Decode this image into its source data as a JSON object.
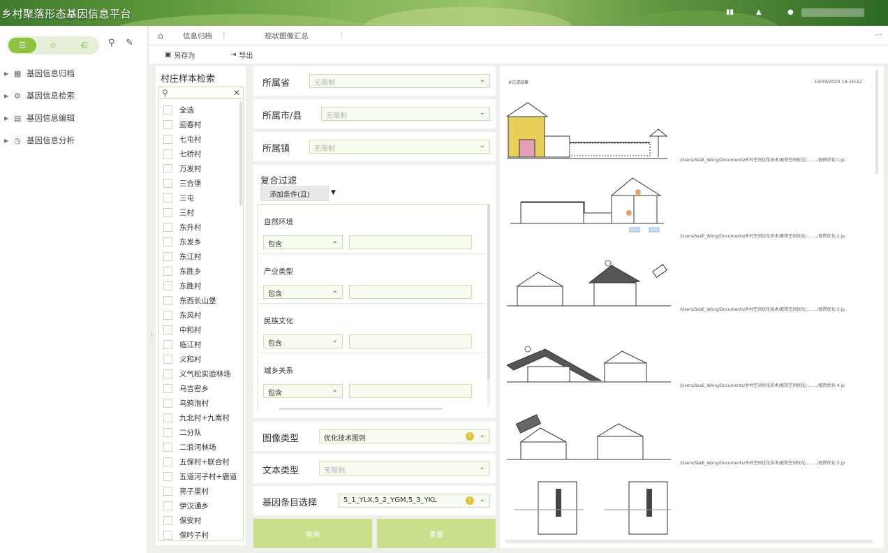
{
  "header": {
    "title": "乡村聚落形态基因信息平台"
  },
  "sidebar": {
    "menu": [
      {
        "label": "基因信息归档",
        "icon": "grid-icon"
      },
      {
        "label": "基因信息检索",
        "icon": "search-gear-icon"
      },
      {
        "label": "基因信息编辑",
        "icon": "edit-icon"
      },
      {
        "label": "基因信息分析",
        "icon": "clock-chart-icon"
      }
    ]
  },
  "tabs": [
    {
      "label": "信息归档"
    },
    {
      "label": "现状图像汇总"
    }
  ],
  "toolbar": {
    "save_as": "另存为",
    "export": "导出"
  },
  "village_search": {
    "title": "村庄样本检索",
    "items": [
      "全选",
      "迎春村",
      "七屯村",
      "七桥村",
      "万发村",
      "三合堡",
      "三屯",
      "三村",
      "东升村",
      "东发乡",
      "东江村",
      "东胜乡",
      "东胜村",
      "东西长山堡",
      "东风村",
      "中和村",
      "临江村",
      "义和村",
      "义气松实验林场",
      "乌吉密乡",
      "乌鸦泡村",
      "九北村+九南村",
      "二分队",
      "二浪河林场",
      "五保村+联合村",
      "五道河子村+鹿道",
      "亮子里村",
      "伊汉通乡",
      "保安村",
      "保吟子村"
    ]
  },
  "selects": {
    "province": {
      "label": "所属省",
      "placeholder": "无限制"
    },
    "city": {
      "label": "所属市/县",
      "placeholder": "无限制"
    },
    "town": {
      "label": "所属镇",
      "placeholder": "无限制"
    },
    "image_type": {
      "label": "图像类型",
      "value": "优化技术图则"
    },
    "text_type": {
      "label": "文本类型",
      "placeholder": "无限制"
    },
    "gene_entry": {
      "label": "基因条目选择",
      "value": "5_1_YLX,5_2_YGM,5_3_YKL"
    }
  },
  "filter": {
    "title": "复合过滤",
    "add_condition": "添加条件(且)",
    "groups": [
      {
        "label": "自然环境",
        "op": "包含"
      },
      {
        "label": "产业类型",
        "op": "包含"
      },
      {
        "label": "民族文化",
        "op": "包含"
      },
      {
        "label": "城乡关系",
        "op": "包含"
      }
    ]
  },
  "buttons": {
    "query": "查询",
    "reset": "重置"
  },
  "results": {
    "header": "#过滤结果",
    "timestamp": "13/04/2020  18:16:22",
    "rows": [
      {
        "path": "/Users/SesE_Wong/Documents/乡村空间优化技术/庭院空间优化/......../庭院优化-1.jp"
      },
      {
        "path": "/Users/SesE_Wong/Documents/乡村空间优化技术/庭院空间优化/......../庭院优化-2.jp"
      },
      {
        "path": "/Users/SesE_Wong/Documents/乡村空间优化技术/庭院空间优化/......../庭院优化-3.jp"
      },
      {
        "path": "/Users/SesE_Wong/Documents/乡村空间优化技术/庭院空间优化/......../庭院优化-4.jp"
      },
      {
        "path": "/Users/SesE_Wong/Documents/乡村空间优化技术/庭院空间优化/......../庭院优化-5.jp"
      }
    ]
  },
  "colors": {
    "accent": "#8dc341",
    "button": "#c9df8b",
    "border": "#c9dfae"
  }
}
